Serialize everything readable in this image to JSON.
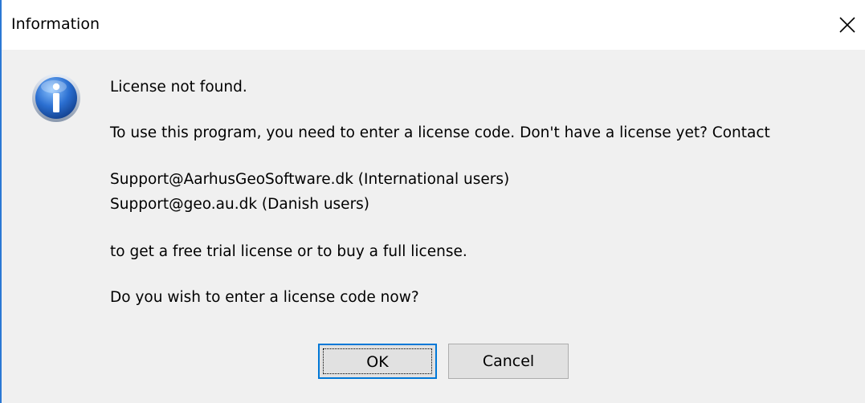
{
  "window": {
    "title": "Information",
    "close_icon": "close-icon"
  },
  "message": {
    "icon": "info-icon",
    "line1": "License not found.",
    "line2": "To use this program, you need to enter a license code. Don't have a license yet? Contact",
    "line3": "Support@AarhusGeoSoftware.dk (International users)",
    "line4": "Support@geo.au.dk (Danish users)",
    "line5": "to get a free trial license or to buy a full license.",
    "line6": "Do you wish to enter a license code now?"
  },
  "buttons": {
    "ok_label": "OK",
    "cancel_label": "Cancel"
  },
  "colors": {
    "accent": "#0078d7",
    "dialog_bg": "#f0f0f0",
    "button_bg": "#e1e1e1"
  }
}
